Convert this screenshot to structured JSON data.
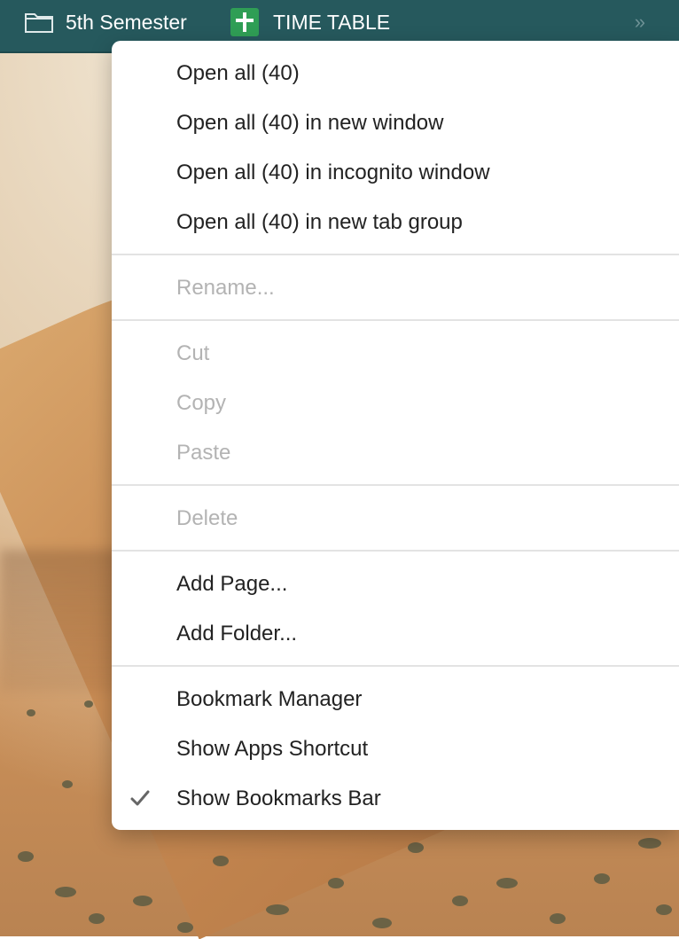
{
  "bookmarks_bar": {
    "folder_label": "5th Semester",
    "sheet_label": "TIME TABLE",
    "overflow_glyph": "»",
    "folder_icon": "folder-icon",
    "sheet_icon": "google-sheets-icon"
  },
  "menu": {
    "open_all": "Open all (40)",
    "open_all_window": "Open all (40) in new window",
    "open_all_incognito": "Open all (40) in incognito window",
    "open_all_tab_group": "Open all (40) in new tab group",
    "rename": "Rename...",
    "cut": "Cut",
    "copy": "Copy",
    "paste": "Paste",
    "delete": "Delete",
    "add_page": "Add Page...",
    "add_folder": "Add Folder...",
    "bookmark_manager": "Bookmark Manager",
    "show_apps_shortcut": "Show Apps Shortcut",
    "show_bookmarks_bar": "Show Bookmarks Bar"
  },
  "colors": {
    "bar_bg": "#26595d",
    "menu_text": "#222222",
    "disabled_text": "#b3b3b3"
  }
}
